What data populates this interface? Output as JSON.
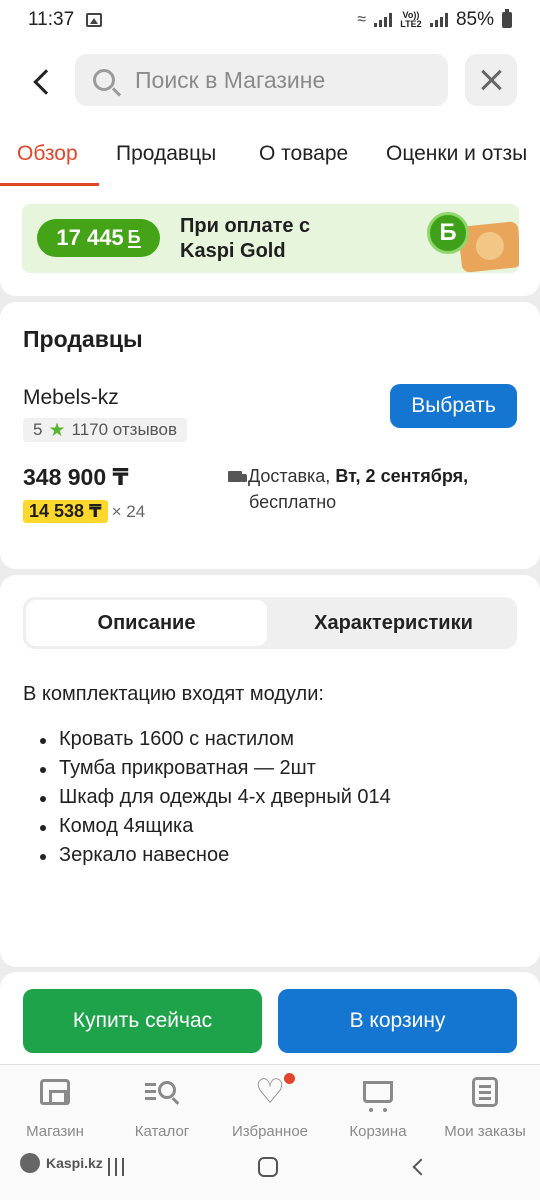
{
  "status_bar": {
    "time": "11:37",
    "volte": "Vo)) LTE2",
    "battery": "85%"
  },
  "header": {
    "search_placeholder": "Поиск в Магазине"
  },
  "tabs": [
    {
      "label": "Обзор",
      "active": true
    },
    {
      "label": "Продавцы",
      "active": false
    },
    {
      "label": "О товаре",
      "active": false
    },
    {
      "label": "Оценки и отзы",
      "active": false
    }
  ],
  "promo": {
    "bonus_amount": "17 445",
    "bonus_symbol": "Б",
    "text_line1": "При оплате с",
    "text_line2": "Kaspi Gold",
    "coin_letter": "Б"
  },
  "sellers": {
    "title": "Продавцы",
    "seller_name": "Mebels-kz",
    "rating_value": "5",
    "reviews": "1170 отзывов",
    "select_label": "Выбрать",
    "price": "348 900 ₸",
    "installment_amount": "14 538 ₸",
    "installment_multiplier": "× 24",
    "delivery_prefix": "Доставка,",
    "delivery_date": "Вт, 2 сентября,",
    "delivery_cost": "бесплатно"
  },
  "description": {
    "tab_description": "Описание",
    "tab_specs": "Характеристики",
    "intro": "В комплектацию входят модули:",
    "items": [
      "Кровать 1600 с настилом",
      "Тумба прикроватная — 2шт",
      "Шкаф для одежды 4-х дверный 014",
      "Комод 4ящика",
      "Зеркало навесное"
    ]
  },
  "actions": {
    "buy_now": "Купить сейчас",
    "add_to_cart": "В корзину"
  },
  "bottom_nav": [
    {
      "label": "Магазин",
      "icon": "store-icon"
    },
    {
      "label": "Каталог",
      "icon": "catalog-icon"
    },
    {
      "label": "Избранное",
      "icon": "heart-icon"
    },
    {
      "label": "Корзина",
      "icon": "cart-icon"
    },
    {
      "label": "Мои заказы",
      "icon": "orders-icon"
    }
  ],
  "system": {
    "watermark": "Kaspi.kz"
  },
  "colors": {
    "accent_red": "#e0462b",
    "primary_blue": "#1576d1",
    "buy_green": "#1ea24a",
    "bonus_green": "#44a317",
    "installment_yellow": "#ffd82b"
  }
}
